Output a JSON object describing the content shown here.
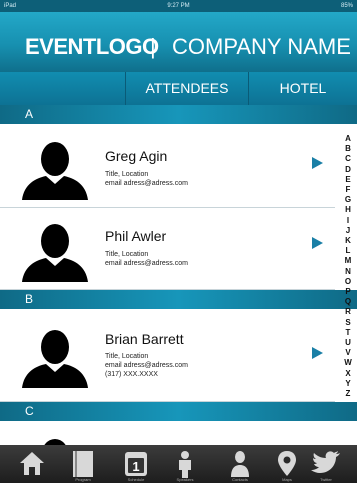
{
  "status_bar": {
    "left": "iPad",
    "time": "9:27 PM",
    "right": "85%"
  },
  "header": {
    "logo": "EVENTLOGO",
    "divider": "|",
    "company": "COMPANY NAME"
  },
  "tabs": [
    {
      "label": "ATTENDEES"
    },
    {
      "label": "HOTEL"
    }
  ],
  "sections": [
    {
      "letter": "A"
    },
    {
      "letter": "B"
    },
    {
      "letter": "C"
    }
  ],
  "attendees": [
    {
      "name": "Greg Agin",
      "title": "Title, Location",
      "email": "email adress@adress.com"
    },
    {
      "name": "Phil Awler",
      "title": "Title, Location",
      "email": "email adress@adress.com"
    },
    {
      "name": "Brian Barrett",
      "title": "Title, Location",
      "email": "email adress@adress.com",
      "phone": "(317) XXX.XXXX"
    }
  ],
  "alpha_index": [
    "A",
    "B",
    "C",
    "D",
    "E",
    "F",
    "G",
    "H",
    "I",
    "J",
    "K",
    "L",
    "M",
    "N",
    "O",
    "P",
    "Q",
    "R",
    "S",
    "T",
    "U",
    "V",
    "W",
    "X",
    "Y",
    "Z"
  ],
  "tab_bar": [
    {
      "label": "",
      "icon": "home-icon"
    },
    {
      "label": "Program",
      "icon": "book-icon"
    },
    {
      "label": "Schedule",
      "icon": "calendar-icon",
      "day": "1"
    },
    {
      "label": "Speakers",
      "icon": "speaker-icon"
    },
    {
      "label": "Contacts",
      "icon": "person-icon"
    },
    {
      "label": "Maps",
      "icon": "map-pin-icon"
    },
    {
      "label": "Twitter",
      "icon": "twitter-bird-icon"
    }
  ],
  "colors": {
    "accent": "#1790b0",
    "arrow": "#1a7fa6",
    "tabbar": "#2a2a2a"
  }
}
